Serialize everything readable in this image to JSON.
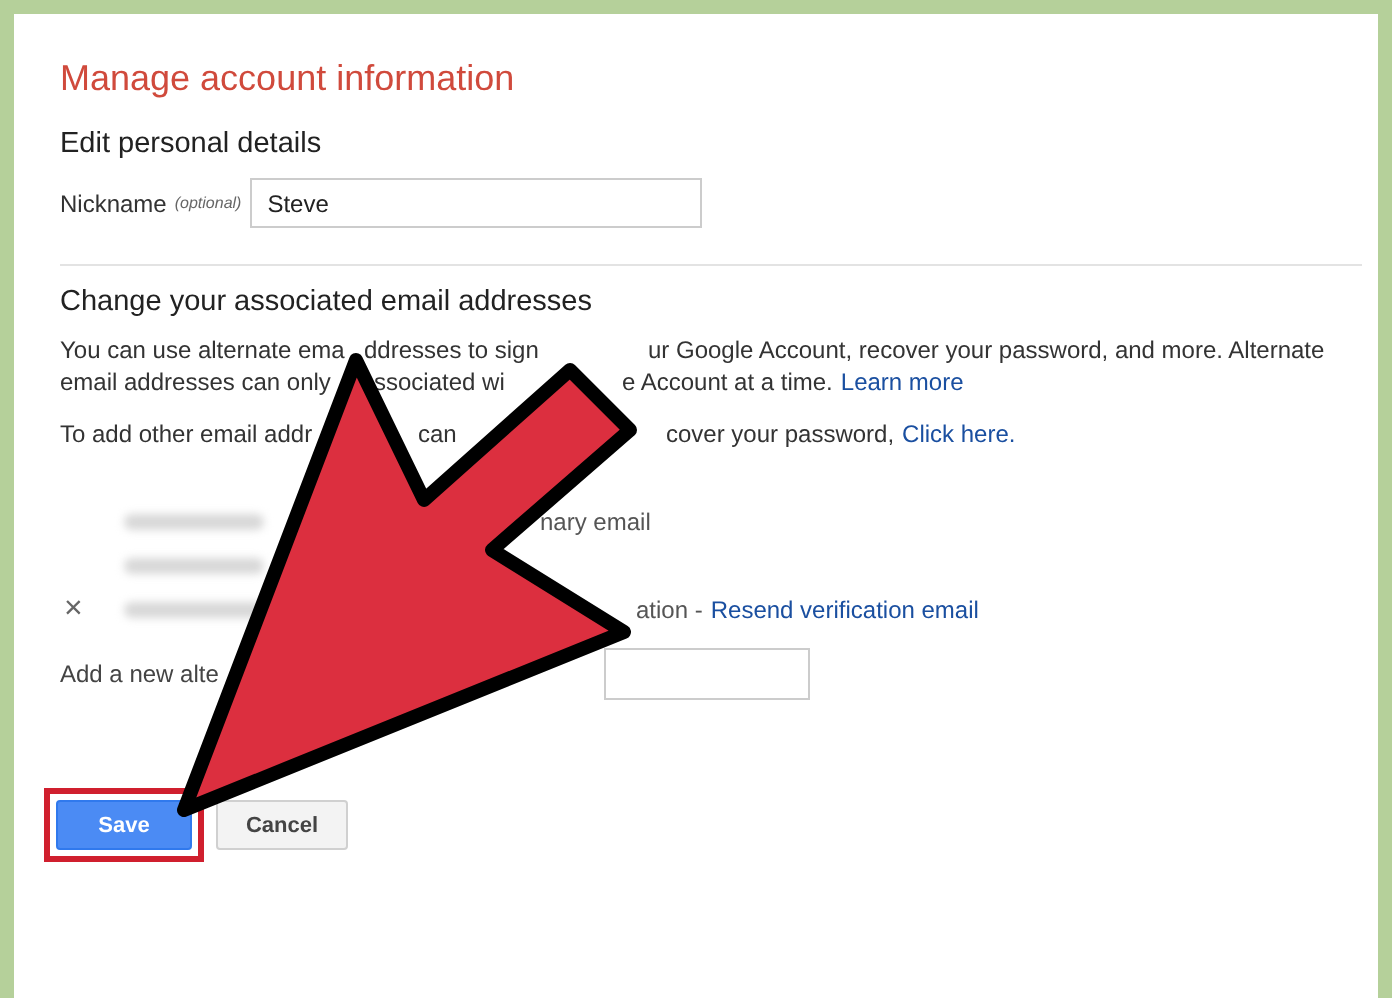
{
  "title": "Manage account information",
  "personal": {
    "heading": "Edit personal details",
    "nickname_label": "Nickname",
    "optional_note": "(optional)",
    "nickname_value": "Steve"
  },
  "emails": {
    "heading": "Change your associated email addresses",
    "paragraph_lines": [
      {
        "fragments": [
          {
            "text": "You can use alternate ema"
          },
          {
            "text": "ddresses to sign"
          },
          {
            "text": "ur Google Account, recover your password, and more. Alternate"
          }
        ]
      },
      {
        "fragments": [
          {
            "text": "email addresses can only"
          },
          {
            "text": "ssociated wi"
          },
          {
            "text": "e Account at a time."
          },
          {
            "text": "Learn more",
            "kind": "link"
          }
        ]
      },
      {
        "fragments": [
          {
            "text": "To add other email addr"
          },
          {
            "text": "can"
          },
          {
            "text": "cover your password,"
          },
          {
            "text": "Click here.",
            "kind": "link"
          }
        ]
      }
    ],
    "addresses": [
      {
        "kind": "primary",
        "note": "nary email"
      },
      {
        "kind": "alternate"
      },
      {
        "kind": "pending",
        "remove_icon": "×",
        "note": "ation -",
        "link": "Resend verification email"
      }
    ],
    "add_label": "Add a new alte"
  },
  "buttons": [
    {
      "label": "Save",
      "primary": true,
      "highlighted": true
    },
    {
      "label": "Cancel",
      "primary": false,
      "highlighted": false
    }
  ]
}
